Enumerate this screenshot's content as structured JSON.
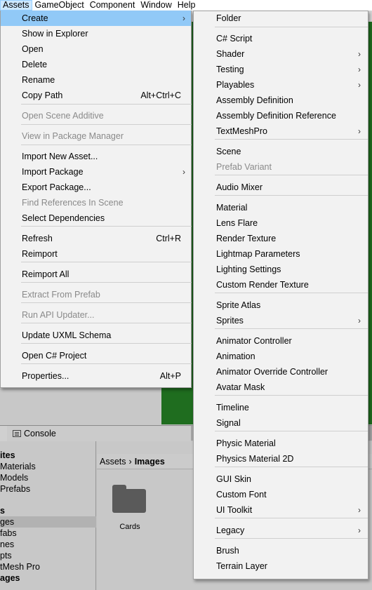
{
  "menubar": [
    "Assets",
    "GameObject",
    "Component",
    "Window",
    "Help"
  ],
  "assets_menu": {
    "items": [
      {
        "label": "Create",
        "submenu": true,
        "highlighted": true
      },
      {
        "label": "Show in Explorer"
      },
      {
        "label": "Open"
      },
      {
        "label": "Delete"
      },
      {
        "label": "Rename"
      },
      {
        "label": "Copy Path",
        "shortcut": "Alt+Ctrl+C"
      },
      {
        "label": "Open Scene Additive",
        "disabled": true
      },
      {
        "label": "View in Package Manager",
        "disabled": true
      },
      {
        "label": "Import New Asset..."
      },
      {
        "label": "Import Package",
        "submenu": true
      },
      {
        "label": "Export Package..."
      },
      {
        "label": "Find References In Scene",
        "disabled": true
      },
      {
        "label": "Select Dependencies"
      },
      {
        "label": "Refresh",
        "shortcut": "Ctrl+R"
      },
      {
        "label": "Reimport"
      },
      {
        "label": "Reimport All"
      },
      {
        "label": "Extract From Prefab",
        "disabled": true
      },
      {
        "label": "Run API Updater...",
        "disabled": true
      },
      {
        "label": "Update UXML Schema"
      },
      {
        "label": "Open C# Project"
      },
      {
        "label": "Properties...",
        "shortcut": "Alt+P"
      }
    ]
  },
  "create_submenu": {
    "items": [
      {
        "label": "Folder"
      },
      {
        "label": "C# Script"
      },
      {
        "label": "Shader",
        "submenu": true
      },
      {
        "label": "Testing",
        "submenu": true
      },
      {
        "label": "Playables",
        "submenu": true
      },
      {
        "label": "Assembly Definition"
      },
      {
        "label": "Assembly Definition Reference"
      },
      {
        "label": "TextMeshPro",
        "submenu": true
      },
      {
        "label": "Scene"
      },
      {
        "label": "Prefab Variant",
        "disabled": true
      },
      {
        "label": "Audio Mixer"
      },
      {
        "label": "Material"
      },
      {
        "label": "Lens Flare"
      },
      {
        "label": "Render Texture"
      },
      {
        "label": "Lightmap Parameters"
      },
      {
        "label": "Lighting Settings"
      },
      {
        "label": "Custom Render Texture"
      },
      {
        "label": "Sprite Atlas"
      },
      {
        "label": "Sprites",
        "submenu": true
      },
      {
        "label": "Animator Controller"
      },
      {
        "label": "Animation"
      },
      {
        "label": "Animator Override Controller"
      },
      {
        "label": "Avatar Mask"
      },
      {
        "label": "Timeline"
      },
      {
        "label": "Signal"
      },
      {
        "label": "Physic Material"
      },
      {
        "label": "Physics Material 2D"
      },
      {
        "label": "GUI Skin"
      },
      {
        "label": "Custom Font"
      },
      {
        "label": "UI Toolkit",
        "submenu": true
      },
      {
        "label": "Legacy",
        "submenu": true
      },
      {
        "label": "Brush"
      },
      {
        "label": "Terrain Layer"
      }
    ]
  },
  "console_tab": {
    "label": "Console",
    "icon": "console-icon"
  },
  "project_tree": [
    {
      "label": "ites",
      "bold": true
    },
    {
      "label": "Materials"
    },
    {
      "label": "Models"
    },
    {
      "label": "Prefabs"
    },
    {
      "label": "s",
      "bold": true
    },
    {
      "label": "ges",
      "selected": true
    },
    {
      "label": "fabs"
    },
    {
      "label": "nes"
    },
    {
      "label": "pts"
    },
    {
      "label": "tMesh Pro"
    },
    {
      "label": "ages",
      "bold": true
    }
  ],
  "breadcrumb": {
    "root": "Assets",
    "separator": "›",
    "current": "Images"
  },
  "folder": {
    "label": "Cards",
    "icon": "folder-icon"
  },
  "colors": {
    "highlight": "#91c9f7",
    "menu_bg": "#f2f2f2",
    "scene_green": "#1f6d1f"
  }
}
